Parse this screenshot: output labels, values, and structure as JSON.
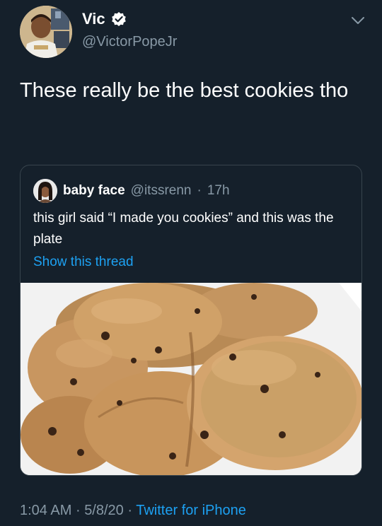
{
  "tweet": {
    "display_name": "Vic",
    "handle": "@VictorPopeJr",
    "text": "These really be the best cookies tho",
    "menu_icon": "chevron-down-icon",
    "verified_icon": "verified-badge-icon"
  },
  "quoted_tweet": {
    "display_name": "baby face",
    "handle": "@itssrenn",
    "separator": "·",
    "time": "17h",
    "text": "this girl said “I made you cookies” and this was the plate",
    "show_thread": "Show this thread",
    "image": "photo of chocolate chip cookies on a white plate"
  },
  "footer": {
    "time": "1:04 AM",
    "sep1": "·",
    "date": "5/8/20",
    "sep2": "·",
    "source": "Twitter for iPhone"
  },
  "colors": {
    "background": "#15202b",
    "secondary_text": "#8899a6",
    "link": "#1da1f2",
    "border": "#38444d"
  }
}
